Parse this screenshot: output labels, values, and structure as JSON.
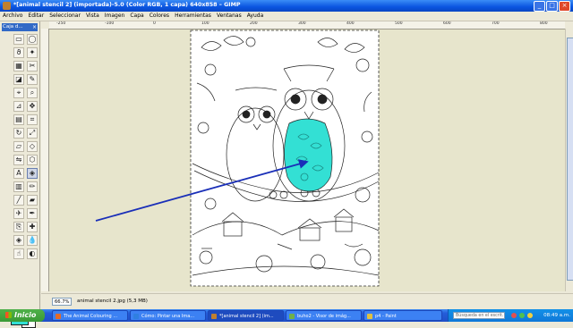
{
  "window": {
    "title": "*[animal stencil 2] (importada)-5.0 (Color RGB, 1 capa) 640x858 – GIMP",
    "buttons": [
      "_",
      "□",
      "×"
    ]
  },
  "menu": {
    "items": [
      "Archivo",
      "Editar",
      "Seleccionar",
      "Vista",
      "Imagen",
      "Capa",
      "Colores",
      "Herramientas",
      "Ventanas",
      "Ayuda"
    ]
  },
  "toolbox": {
    "title": "Caja d...",
    "close": "×",
    "tools": [
      {
        "name": "rect-select-tool",
        "glyph": "▭"
      },
      {
        "name": "ellipse-select-tool",
        "glyph": "◯"
      },
      {
        "name": "free-select-tool",
        "glyph": "ϑ"
      },
      {
        "name": "fuzzy-select-tool",
        "glyph": "✦"
      },
      {
        "name": "color-select-tool",
        "glyph": "▦"
      },
      {
        "name": "scissors-tool",
        "glyph": "✂"
      },
      {
        "name": "foreground-select-tool",
        "glyph": "◪"
      },
      {
        "name": "paths-tool",
        "glyph": "✎"
      },
      {
        "name": "color-picker-tool",
        "glyph": "⌖"
      },
      {
        "name": "zoom-tool",
        "glyph": "⌕"
      },
      {
        "name": "measure-tool",
        "glyph": "⊿"
      },
      {
        "name": "move-tool",
        "glyph": "✥"
      },
      {
        "name": "align-tool",
        "glyph": "▤"
      },
      {
        "name": "crop-tool",
        "glyph": "⌗"
      },
      {
        "name": "rotate-tool",
        "glyph": "↻"
      },
      {
        "name": "scale-tool",
        "glyph": "⤢"
      },
      {
        "name": "shear-tool",
        "glyph": "▱"
      },
      {
        "name": "perspective-tool",
        "glyph": "◇"
      },
      {
        "name": "flip-tool",
        "glyph": "⇋"
      },
      {
        "name": "cage-tool",
        "glyph": "⬡"
      },
      {
        "name": "text-tool",
        "glyph": "A"
      },
      {
        "name": "bucket-fill-tool",
        "glyph": "◈"
      },
      {
        "name": "blend-tool",
        "glyph": "▥"
      },
      {
        "name": "pencil-tool",
        "glyph": "✏"
      },
      {
        "name": "paintbrush-tool",
        "glyph": "╱"
      },
      {
        "name": "eraser-tool",
        "glyph": "▰"
      },
      {
        "name": "airbrush-tool",
        "glyph": "✈"
      },
      {
        "name": "ink-tool",
        "glyph": "✒"
      },
      {
        "name": "clone-tool",
        "glyph": "⎘"
      },
      {
        "name": "heal-tool",
        "glyph": "✚"
      },
      {
        "name": "perspective-clone-tool",
        "glyph": "◈"
      },
      {
        "name": "blur-tool",
        "glyph": "💧"
      },
      {
        "name": "smudge-tool",
        "glyph": "☝"
      },
      {
        "name": "dodge-burn-tool",
        "glyph": "◐"
      }
    ],
    "fg_color": "#33e0d4",
    "bg_color": "#ffffff"
  },
  "ruler": {
    "ticks": [
      "-250",
      "-100",
      "0",
      "100",
      "200",
      "300",
      "400",
      "500",
      "600",
      "700",
      "800"
    ]
  },
  "canvas": {
    "background": "#e7e5cc",
    "highlight_color": "#33e0d4",
    "arrow_color": "#1a2fb8"
  },
  "status": {
    "zoom": "66.7%",
    "text": "animal stencil 2.jpg (5,3 MB)"
  },
  "taskbar": {
    "start": "Inicio",
    "tasks": [
      {
        "label": "The Animal Colouring ...",
        "color": "#e46a2a"
      },
      {
        "label": "Cómo: Pintar una Ima...",
        "color": "#2f7fe0"
      },
      {
        "label": "*[animal stencil 2] (im...",
        "color": "#c08030"
      },
      {
        "label": "buho2 - Visor de imág...",
        "color": "#6fb04a"
      },
      {
        "label": "p4 - Paint",
        "color": "#e0c040"
      }
    ],
    "search_placeholder": "Búsqueda en el escrit...",
    "clock": "08:49 a.m."
  }
}
